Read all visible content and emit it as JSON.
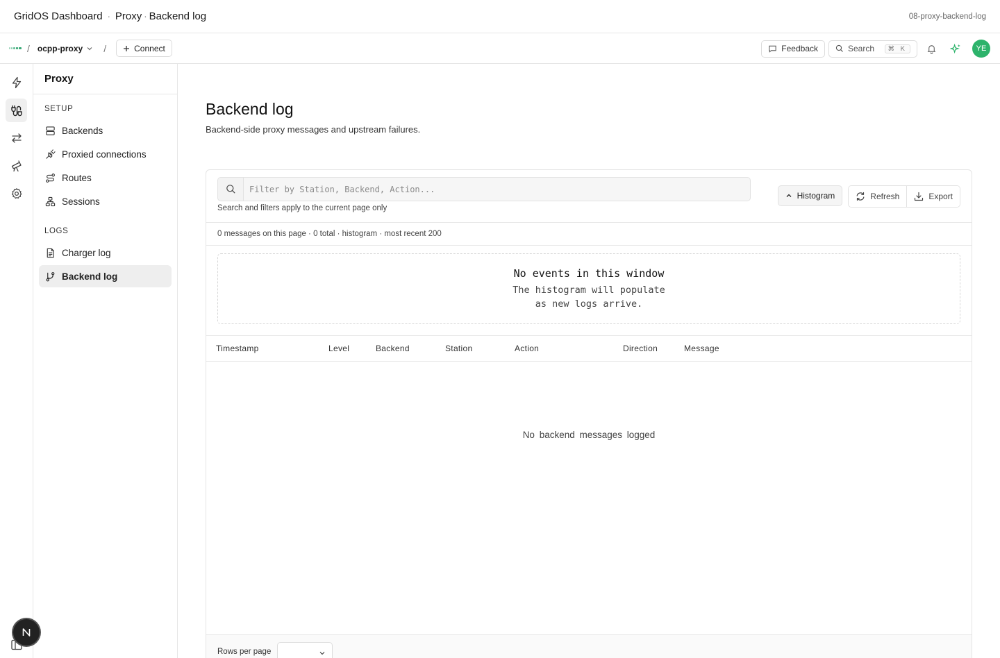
{
  "titlebar": {
    "app": "GridOS Dashboard",
    "separator": "·",
    "section": "Proxy",
    "separator2": "·",
    "page": "Backend log",
    "page_id": "08-proxy-backend-log"
  },
  "topnav": {
    "crumb_sep": "/",
    "project": "ocpp-proxy",
    "crumb_sep2": "/",
    "connect_label": "Connect",
    "feedback_label": "Feedback",
    "search_label": "Search",
    "search_shortcut": "⌘ K",
    "avatar_initials": "YE"
  },
  "sidebar": {
    "title": "Proxy",
    "setup_heading": "SETUP",
    "setup_items": [
      {
        "label": "Backends",
        "icon": "server-stack-icon"
      },
      {
        "label": "Proxied connections",
        "icon": "plug-icon"
      },
      {
        "label": "Routes",
        "icon": "route-icon"
      },
      {
        "label": "Sessions",
        "icon": "network-icon"
      }
    ],
    "logs_heading": "LOGS",
    "logs_items": [
      {
        "label": "Charger log",
        "icon": "file-text-icon"
      },
      {
        "label": "Backend log",
        "icon": "git-branch-icon",
        "active": true
      }
    ]
  },
  "main": {
    "title": "Backend log",
    "subtitle": "Backend-side proxy messages and upstream failures.",
    "filter_placeholder": "Filter by Station, Backend, Action...",
    "filter_note": "Search and filters apply to the current page only",
    "histogram_label": "Histogram",
    "refresh_label": "Refresh",
    "export_label": "Export",
    "summary": "0 messages on this page · 0 total · histogram · most recent 200",
    "histogram_empty_title": "No events in this window",
    "histogram_empty_line1": "The histogram will populate",
    "histogram_empty_line2": "as new logs arrive.",
    "columns": [
      "Timestamp",
      "Level",
      "Backend",
      "Station",
      "Action",
      "Direction",
      "Message"
    ],
    "empty_table": "No backend messages logged",
    "rows_per_page_label": "Rows per page",
    "rows_per_page_value": ""
  },
  "colors": {
    "accent": "#2db36b",
    "logo": "#3aaa78",
    "active_bg": "#eeeeee",
    "border": "#e6e6e6"
  }
}
